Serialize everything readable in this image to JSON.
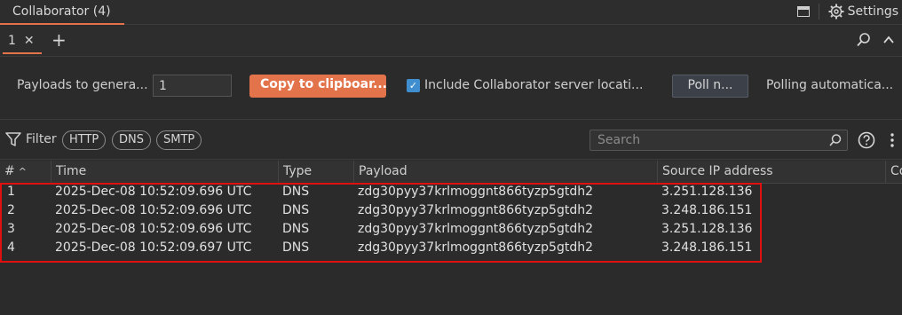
{
  "window": {
    "title": "Collaborator (4)",
    "settings_label": "Settings"
  },
  "tabs": [
    {
      "label": "1"
    }
  ],
  "controls": {
    "payloads_label": "Payloads to genera...",
    "payload_count": "1",
    "copy_button": "Copy to clipboar...",
    "include_checked": true,
    "include_label": "Include Collaborator server locati...",
    "poll_button": "Poll n...",
    "polling_label": "Polling automatica..."
  },
  "filter": {
    "label": "Filter",
    "chips": [
      "HTTP",
      "DNS",
      "SMTP"
    ],
    "search_placeholder": "Search"
  },
  "table": {
    "columns": [
      "#",
      "Time",
      "Type",
      "Payload",
      "Source IP address",
      "Co"
    ],
    "rows": [
      {
        "num": "1",
        "time": "2025-Dec-08 10:52:09.696 UTC",
        "type": "DNS",
        "payload": "zdg30pyy37krlmoggnt866tyzp5gtdh2",
        "ip": "3.251.128.136"
      },
      {
        "num": "2",
        "time": "2025-Dec-08 10:52:09.696 UTC",
        "type": "DNS",
        "payload": "zdg30pyy37krlmoggnt866tyzp5gtdh2",
        "ip": "3.248.186.151"
      },
      {
        "num": "3",
        "time": "2025-Dec-08 10:52:09.696 UTC",
        "type": "DNS",
        "payload": "zdg30pyy37krlmoggnt866tyzp5gtdh2",
        "ip": "3.251.128.136"
      },
      {
        "num": "4",
        "time": "2025-Dec-08 10:52:09.697 UTC",
        "type": "DNS",
        "payload": "zdg30pyy37krlmoggnt866tyzp5gtdh2",
        "ip": "3.248.186.151"
      }
    ]
  },
  "colors": {
    "accent": "#e3734b",
    "highlight": "#e01010",
    "checkbox": "#3e8ed0"
  }
}
